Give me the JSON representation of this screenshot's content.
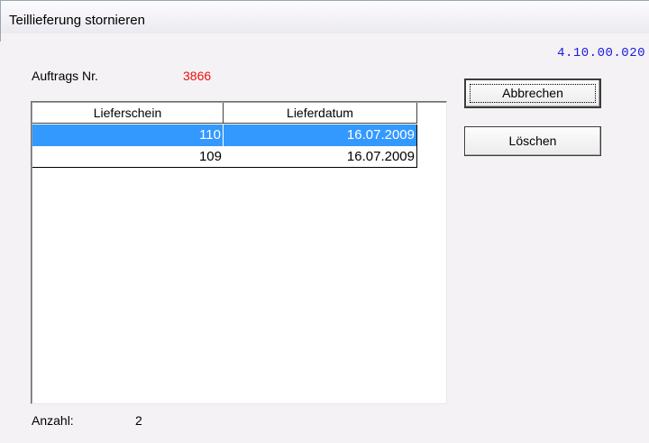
{
  "window": {
    "title": "Teillieferung stornieren",
    "version": "4.10.00.020"
  },
  "order": {
    "label": "Auftrags Nr.",
    "value": "3866"
  },
  "table": {
    "columns": [
      "Lieferschein",
      "Lieferdatum"
    ],
    "rows": [
      {
        "lieferschein": "110",
        "lieferdatum": "16.07.2009",
        "selected": true
      },
      {
        "lieferschein": "109",
        "lieferdatum": "16.07.2009",
        "selected": false
      }
    ]
  },
  "buttons": {
    "cancel": "Abbrechen",
    "delete": "Löschen"
  },
  "count": {
    "label": "Anzahl:",
    "value": "2"
  },
  "colors": {
    "selection": "#3399ff",
    "order_value": "#f01010",
    "version": "#1a1ae6"
  }
}
